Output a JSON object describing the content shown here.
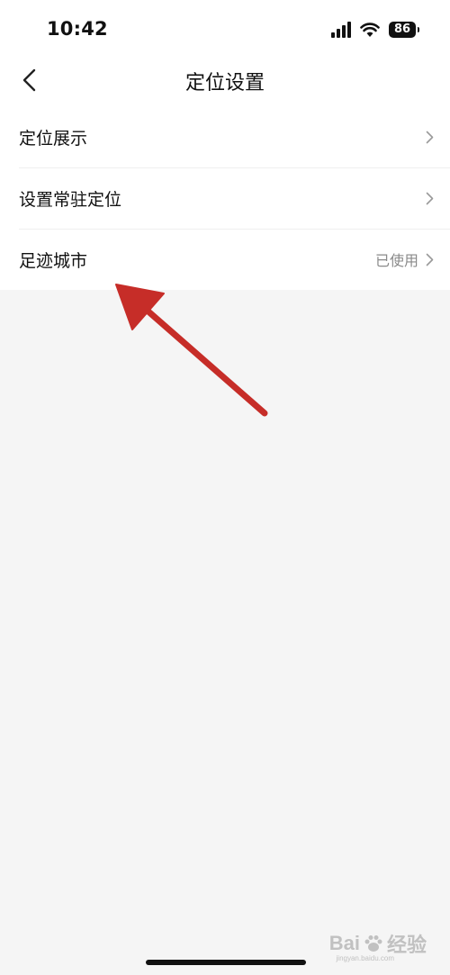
{
  "status_bar": {
    "time": "10:42",
    "battery": "86"
  },
  "nav": {
    "title": "定位设置",
    "back_icon": "chevron-left-icon"
  },
  "settings": {
    "items": [
      {
        "label": "定位展示",
        "value": ""
      },
      {
        "label": "设置常驻定位",
        "value": ""
      },
      {
        "label": "足迹城市",
        "value": "已使用"
      }
    ]
  },
  "watermark": {
    "brand": "Bai",
    "brand_suffix": "经验",
    "site": "jingyan.baidu.com"
  },
  "colors": {
    "annotation_arrow": "#c62d28",
    "background": "#f5f5f5",
    "secondary_text": "#8a8a8a"
  }
}
